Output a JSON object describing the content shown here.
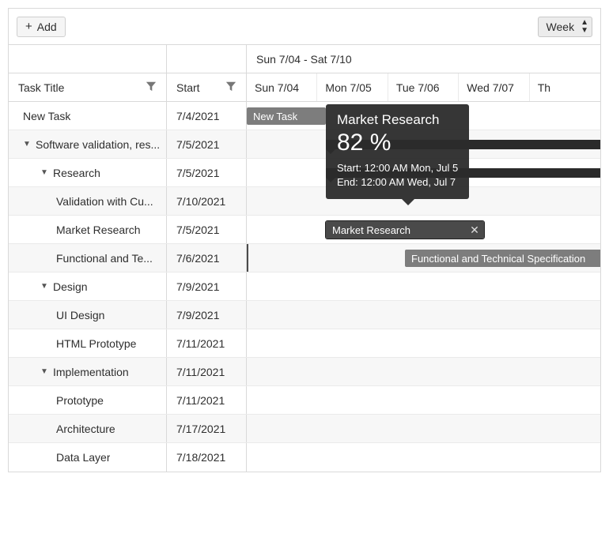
{
  "toolbar": {
    "add_label": "Add",
    "view_label": "Week"
  },
  "headers": {
    "task_title": "Task Title",
    "start": "Start",
    "date_range": "Sun 7/04 - Sat 7/10",
    "days": [
      "Sun 7/04",
      "Mon 7/05",
      "Tue 7/06",
      "Wed 7/07",
      "Th"
    ]
  },
  "tasks": [
    {
      "title": "New Task",
      "start": "7/4/2021"
    },
    {
      "title": "Software validation, res...",
      "start": "7/5/2021"
    },
    {
      "title": "Research",
      "start": "7/5/2021"
    },
    {
      "title": "Validation with Cu...",
      "start": "7/10/2021"
    },
    {
      "title": "Market Research",
      "start": "7/5/2021"
    },
    {
      "title": "Functional and Te...",
      "start": "7/6/2021"
    },
    {
      "title": "Design",
      "start": "7/9/2021"
    },
    {
      "title": "UI Design",
      "start": "7/9/2021"
    },
    {
      "title": "HTML Prototype",
      "start": "7/11/2021"
    },
    {
      "title": "Implementation",
      "start": "7/11/2021"
    },
    {
      "title": "Prototype",
      "start": "7/11/2021"
    },
    {
      "title": "Architecture",
      "start": "7/17/2021"
    },
    {
      "title": "Data Layer",
      "start": "7/18/2021"
    }
  ],
  "bars": {
    "new_task_label": "New Task",
    "market_research_label": "Market Research",
    "functional_label": "Functional and Technical Specification"
  },
  "tooltip": {
    "title": "Market Research",
    "percent": "82 %",
    "start_line": "Start: 12:00 AM Mon, Jul 5",
    "end_line": "End: 12:00 AM Wed, Jul 7"
  }
}
